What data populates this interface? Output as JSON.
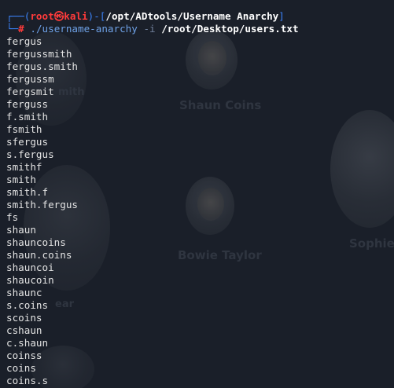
{
  "prompt": {
    "box_top": "┌──(",
    "user": "root",
    "skull": "㉿",
    "host": "kali",
    "sep": ")-[",
    "path": "/opt/ADtools/Username Anarchy",
    "close": "]",
    "box_bottom": "└─",
    "hash": "#",
    "command": "./username-anarchy",
    "flag": "-i",
    "argument": "/root/Desktop/users.txt"
  },
  "output_lines": [
    "fergus",
    "fergussmith",
    "fergus.smith",
    "fergussm",
    "fergsmit",
    "ferguss",
    "f.smith",
    "fsmith",
    "sfergus",
    "s.fergus",
    "smithf",
    "smith",
    "smith.f",
    "smith.fergus",
    "fs",
    "shaun",
    "shauncoins",
    "shaun.coins",
    "shauncoi",
    "shaucoin",
    "shaunc",
    "s.coins",
    "scoins",
    "cshaun",
    "c.shaun",
    "coinss",
    "coins",
    "coins.s"
  ],
  "background": {
    "names": [
      "Shaun Coins",
      "Bowie Taylor",
      "Sophie",
      "mith",
      "ear"
    ]
  }
}
